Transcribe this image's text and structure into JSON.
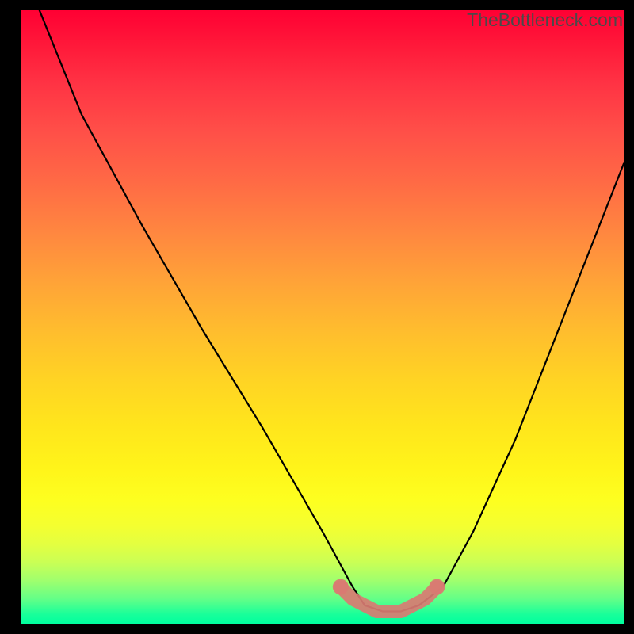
{
  "watermark": "TheBottleneck.com",
  "chart_data": {
    "type": "line",
    "title": "",
    "xlabel": "",
    "ylabel": "",
    "xlim": [
      0,
      100
    ],
    "ylim": [
      0,
      100
    ],
    "background_gradient": {
      "top": "#ff0033",
      "mid": "#ffd324",
      "bottom": "#00ff9e"
    },
    "series": [
      {
        "name": "bottleneck-curve",
        "color": "#000000",
        "x": [
          3,
          10,
          20,
          30,
          40,
          50,
          55,
          57,
          60,
          63,
          66,
          70,
          75,
          82,
          90,
          100
        ],
        "values": [
          100,
          83,
          65,
          48,
          32,
          15,
          6,
          3,
          2,
          2,
          3,
          6,
          15,
          30,
          50,
          75
        ]
      }
    ],
    "highlight": {
      "name": "optimal-zone",
      "color": "#d97b72",
      "x": [
        53,
        55,
        57,
        59,
        61,
        63,
        65,
        67,
        69
      ],
      "values": [
        6,
        4,
        3,
        2,
        2,
        2,
        3,
        4,
        6
      ]
    }
  }
}
